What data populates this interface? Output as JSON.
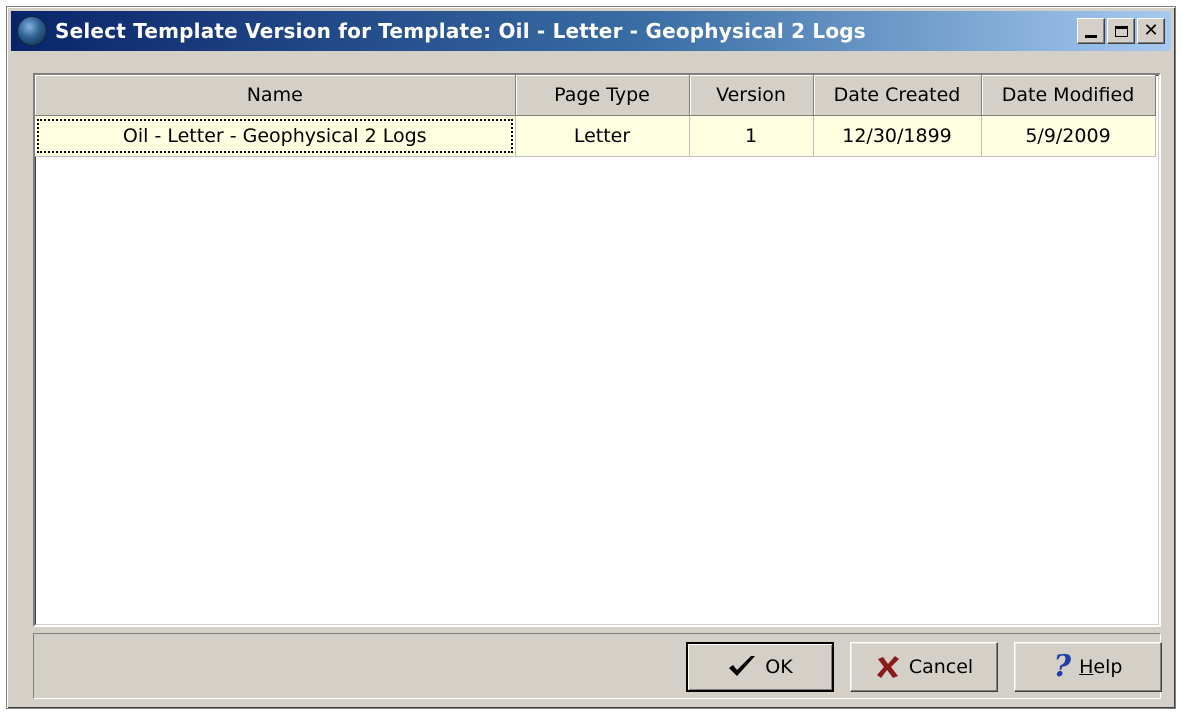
{
  "window": {
    "title": "Select Template Version for Template: Oil - Letter - Geophysical 2 Logs"
  },
  "grid": {
    "columns": [
      "Name",
      "Page Type",
      "Version",
      "Date Created",
      "Date Modified"
    ],
    "rows": [
      [
        "Oil - Letter - Geophysical 2 Logs",
        "Letter",
        "1",
        "12/30/1899",
        "5/9/2009"
      ]
    ]
  },
  "buttons": {
    "ok_label": "OK",
    "cancel_label": "Cancel",
    "help_label_rest": "elp",
    "help_label_mnemonic": "H"
  },
  "icons": {
    "app": "globe-icon",
    "ok": "check-icon",
    "cancel": "x-icon",
    "help": "question-icon"
  },
  "colors": {
    "titlebar_start": "#0a246a",
    "titlebar_end": "#a6caf0",
    "row_background": "#ffffe1",
    "dialog_face": "#d4d0c8"
  }
}
